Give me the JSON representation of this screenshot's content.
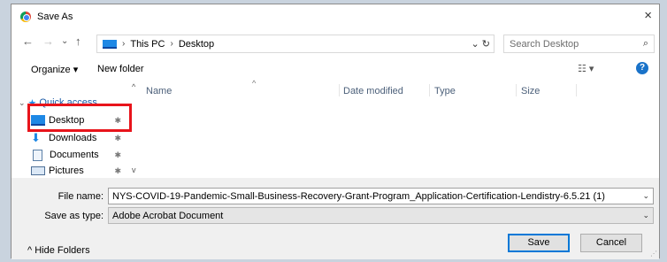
{
  "window": {
    "title": "Save As",
    "close": "×"
  },
  "nav": {
    "back": "←",
    "forward": "→",
    "recent": "⌄",
    "up": "↑",
    "breadcrumb_sep": "›",
    "breadcrumb": [
      "This PC",
      "Desktop"
    ],
    "addr_controls": "⌄  ↻",
    "search_placeholder": "Search Desktop",
    "search_icon": "⌕"
  },
  "toolbar": {
    "organize": "Organize ▾",
    "new_folder": "New folder",
    "view_icon": "☷ ▾",
    "help": "?"
  },
  "sidebar": {
    "quick_access": "Quick access",
    "items": [
      {
        "label": "Desktop",
        "icon": "desktop-icon",
        "pinned": true
      },
      {
        "label": "Downloads",
        "icon": "download-icon",
        "pinned": true
      },
      {
        "label": "Documents",
        "icon": "documents-icon",
        "pinned": true
      },
      {
        "label": "Pictures",
        "icon": "pictures-icon",
        "pinned": true
      }
    ],
    "pin_glyph": "📌",
    "scroll_up": "^",
    "scroll_down": "v"
  },
  "columns": [
    "Name",
    "Date modified",
    "Type",
    "Size"
  ],
  "sort_indicator": "^",
  "form": {
    "file_name_label": "File name:",
    "file_name_value": "NYS-COVID-19-Pandemic-Small-Business-Recovery-Grant-Program_Application-Certification-Lendistry-6.5.21 (1)",
    "save_type_label": "Save as type:",
    "save_type_value": "Adobe Acrobat Document",
    "dropdown_glyph": "⌄"
  },
  "footer": {
    "hide_folders": "^  Hide Folders",
    "save": "Save",
    "cancel": "Cancel",
    "grip": "⋰"
  },
  "colors": {
    "highlight": "#e8141b",
    "accent": "#0078d7"
  }
}
